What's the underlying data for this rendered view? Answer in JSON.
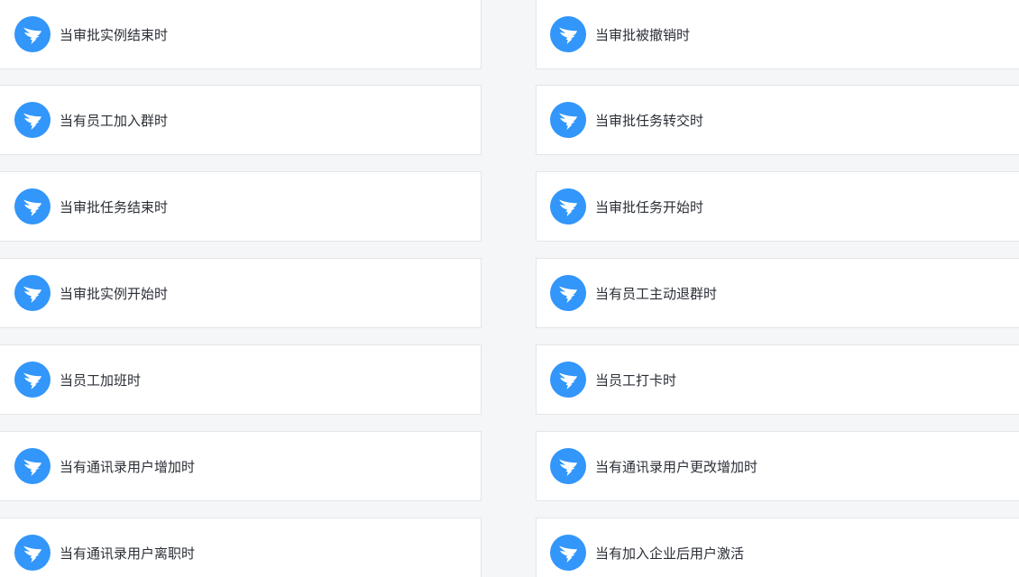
{
  "colors": {
    "icon_bg": "#3296fa",
    "card_bg": "#ffffff",
    "card_border": "#e3e5e8",
    "page_bg": "#f5f6f8",
    "text": "#2b2f36"
  },
  "icon": "dingtalk-logo-icon",
  "triggers": {
    "left": [
      {
        "label": "当审批实例结束时"
      },
      {
        "label": "当有员工加入群时"
      },
      {
        "label": "当审批任务结束时"
      },
      {
        "label": "当审批实例开始时"
      },
      {
        "label": "当员工加班时"
      },
      {
        "label": "当有通讯录用户增加时"
      },
      {
        "label": "当有通讯录用户离职时"
      }
    ],
    "right": [
      {
        "label": "当审批被撤销时"
      },
      {
        "label": "当审批任务转交时"
      },
      {
        "label": "当审批任务开始时"
      },
      {
        "label": "当有员工主动退群时"
      },
      {
        "label": "当员工打卡时"
      },
      {
        "label": "当有通讯录用户更改增加时"
      },
      {
        "label": "当有加入企业后用户激活"
      }
    ]
  }
}
